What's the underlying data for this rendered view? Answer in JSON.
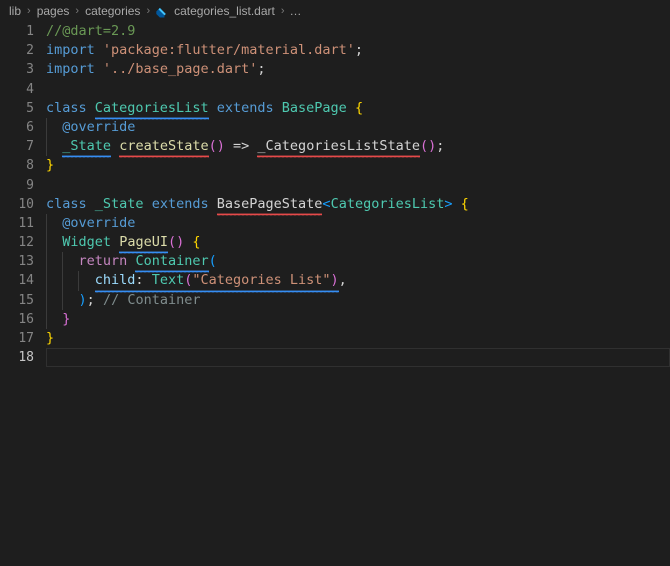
{
  "breadcrumb": {
    "items": [
      {
        "label": "lib",
        "icon": null
      },
      {
        "label": "pages",
        "icon": null
      },
      {
        "label": "categories",
        "icon": null
      },
      {
        "label": "categories_list.dart",
        "icon": "dart-file-icon"
      },
      {
        "label": "…",
        "icon": null
      }
    ],
    "separator": "›"
  },
  "editor": {
    "language": "dart",
    "active_line": 18,
    "total_lines": 18,
    "colors": {
      "background": "#1e1e1e",
      "gutter_text": "#858585",
      "active_gutter_text": "#c6c6c6",
      "comment_green": "#6a9955",
      "comment_gray": "#7f8c8d",
      "keyword": "#569cd6",
      "control": "#c586c0",
      "string": "#ce9178",
      "type": "#4ec9b0",
      "function": "#dcdcaa",
      "variable": "#9cdcfe",
      "plain": "#d4d4d4",
      "bracket_yellow": "#ffd700",
      "bracket_purple": "#da70d6",
      "bracket_blue": "#179fff",
      "error_squiggle": "#f14c4c",
      "info_squiggle": "#3794ff"
    },
    "lines": [
      {
        "n": 1,
        "text": "//@dart=2.9"
      },
      {
        "n": 2,
        "text": "import 'package:flutter/material.dart';"
      },
      {
        "n": 3,
        "text": "import '../base_page.dart';"
      },
      {
        "n": 4,
        "text": ""
      },
      {
        "n": 5,
        "text": "class CategoriesList extends BasePage {"
      },
      {
        "n": 6,
        "text": "  @override"
      },
      {
        "n": 7,
        "text": "  _State createState() => _CategoriesListState();"
      },
      {
        "n": 8,
        "text": "}"
      },
      {
        "n": 9,
        "text": ""
      },
      {
        "n": 10,
        "text": "class _State extends BasePageState<CategoriesList> {"
      },
      {
        "n": 11,
        "text": "  @override"
      },
      {
        "n": 12,
        "text": "  Widget PageUI() {"
      },
      {
        "n": 13,
        "text": "    return Container("
      },
      {
        "n": 14,
        "text": "      child: Text(\"Categories List\"),"
      },
      {
        "n": 15,
        "text": "    ); // Container"
      },
      {
        "n": 16,
        "text": "  }"
      },
      {
        "n": 17,
        "text": "}"
      },
      {
        "n": 18,
        "text": ""
      }
    ]
  }
}
